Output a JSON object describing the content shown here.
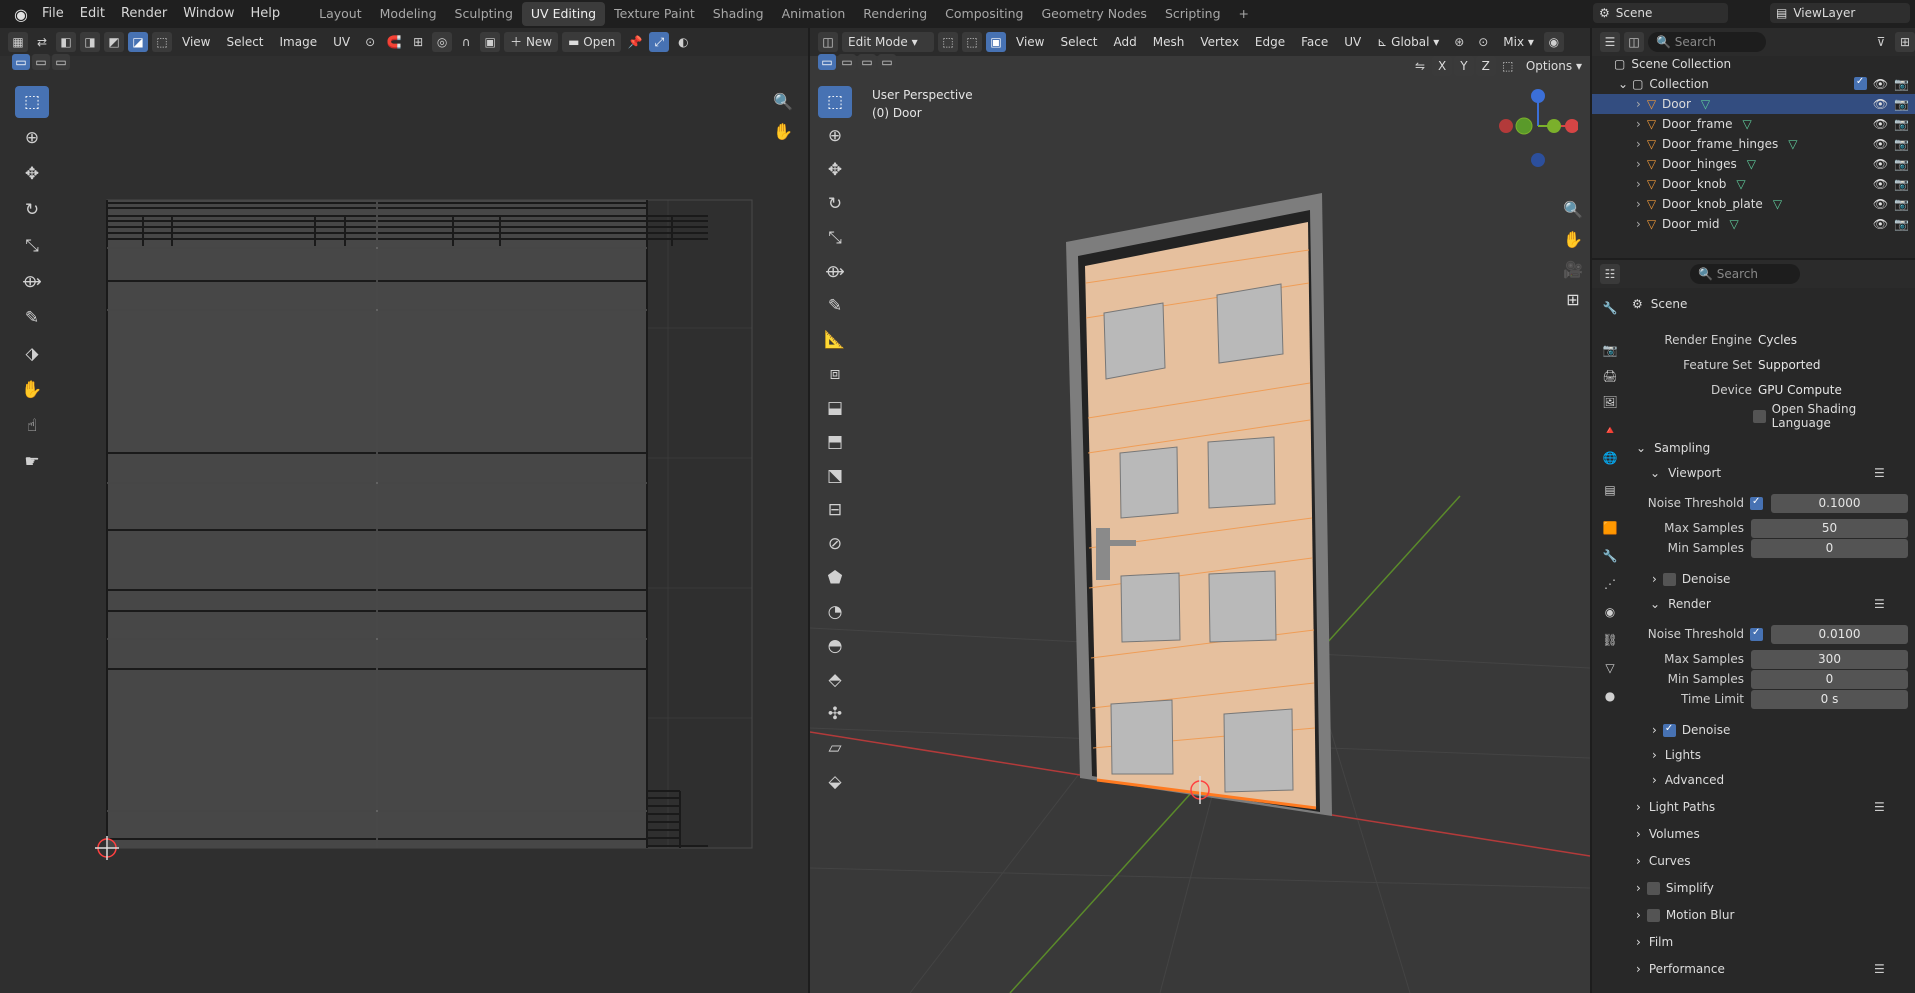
{
  "app": {
    "title": "Blender"
  },
  "menu": [
    "File",
    "Edit",
    "Render",
    "Window",
    "Help"
  ],
  "workspaces": [
    {
      "label": "Layout",
      "active": false
    },
    {
      "label": "Modeling",
      "active": false
    },
    {
      "label": "Sculpting",
      "active": false
    },
    {
      "label": "UV Editing",
      "active": true
    },
    {
      "label": "Texture Paint",
      "active": false
    },
    {
      "label": "Shading",
      "active": false
    },
    {
      "label": "Animation",
      "active": false
    },
    {
      "label": "Rendering",
      "active": false
    },
    {
      "label": "Compositing",
      "active": false
    },
    {
      "label": "Geometry Nodes",
      "active": false
    },
    {
      "label": "Scripting",
      "active": false
    }
  ],
  "add_workspace": "+",
  "scene_name": "Scene",
  "view_layer": "ViewLayer",
  "uv_editor": {
    "menus": [
      "View",
      "Select",
      "Image",
      "UV"
    ],
    "new_label": "New",
    "open_label": "Open"
  },
  "viewport": {
    "mode": "Edit Mode",
    "menus": [
      "View",
      "Select",
      "Add",
      "Mesh",
      "Vertex",
      "Edge",
      "Face",
      "UV"
    ],
    "orientation": "Global",
    "proportional": "Mix",
    "options_label": "Options",
    "axis_x": "X",
    "axis_y": "Y",
    "axis_z": "Z",
    "overlay_title": "User Perspective",
    "overlay_object": "(0) Door"
  },
  "outliner": {
    "search_placeholder": "Search",
    "scene_collection": "Scene Collection",
    "collection": "Collection",
    "objects": [
      "Door",
      "Door_frame",
      "Door_frame_hinges",
      "Door_hinges",
      "Door_knob",
      "Door_knob_plate",
      "Door_mid"
    ],
    "selected": "Door"
  },
  "properties": {
    "search_placeholder": "Search",
    "context": "Scene",
    "render_engine_label": "Render Engine",
    "render_engine": "Cycles",
    "feature_set_label": "Feature Set",
    "feature_set": "Supported",
    "device_label": "Device",
    "device": "GPU Compute",
    "osl_label": "Open Shading Language",
    "sampling": "Sampling",
    "viewport": "Viewport",
    "noise_threshold_label": "Noise Threshold",
    "vp_noise_threshold": "0.1000",
    "max_samples_label": "Max Samples",
    "vp_max_samples": "50",
    "min_samples_label": "Min Samples",
    "vp_min_samples": "0",
    "denoise_label": "Denoise",
    "render": "Render",
    "r_noise_threshold": "0.0100",
    "r_max_samples": "300",
    "r_min_samples": "0",
    "time_limit_label": "Time Limit",
    "time_limit": "0 s",
    "lights": "Lights",
    "advanced": "Advanced",
    "light_paths": "Light Paths",
    "volumes": "Volumes",
    "curves": "Curves",
    "simplify": "Simplify",
    "motion_blur": "Motion Blur",
    "film": "Film",
    "performance": "Performance"
  },
  "colors": {
    "accent": "#4772b3",
    "door": "#e8c2a0",
    "frame": "#8a8a8a",
    "edge": "#f08a30"
  }
}
